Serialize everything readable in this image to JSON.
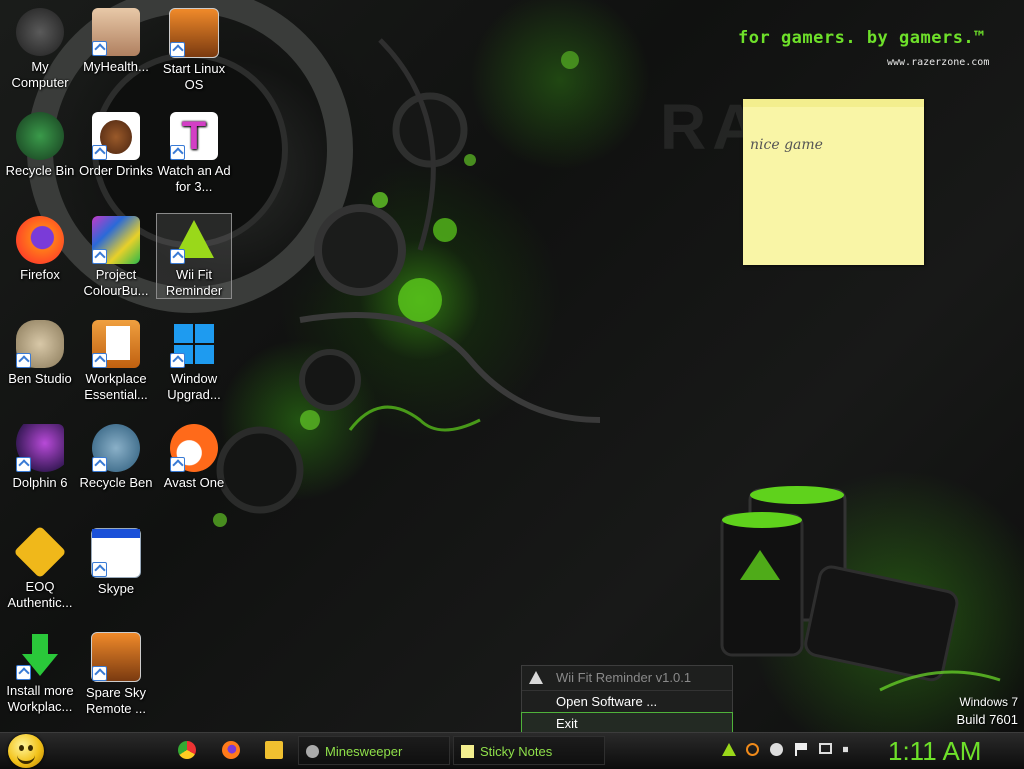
{
  "wallpaper": {
    "tagline": "for gamers. by gamers.™",
    "site": "www.razerzone.com",
    "brand_watermark": "RAZER",
    "accent": "#6ee02a"
  },
  "desktop_icons": [
    {
      "label": "My Computer",
      "icon": "computer-icon",
      "shortcut": false
    },
    {
      "label": "MyHealth...",
      "icon": "avatar-icon",
      "shortcut": true
    },
    {
      "label": "Start Linux OS",
      "icon": "window-app-icon",
      "shortcut": true
    },
    {
      "label": "Recycle Bin",
      "icon": "recycle-bin-icon",
      "shortcut": false
    },
    {
      "label": "Order Drinks",
      "icon": "coffee-bean-icon",
      "shortcut": true
    },
    {
      "label": "Watch an Ad for 3...",
      "icon": "t-letter-icon",
      "shortcut": true
    },
    {
      "label": "Firefox",
      "icon": "firefox-icon",
      "shortcut": false
    },
    {
      "label": "Project ColourBu...",
      "icon": "photo-collage-icon",
      "shortcut": true
    },
    {
      "label": "Wii Fit Reminder",
      "icon": "warning-icon",
      "shortcut": true
    },
    {
      "label": "Ben Studio",
      "icon": "dog-icon",
      "shortcut": true
    },
    {
      "label": "Workplace Essential...",
      "icon": "folder-document-icon",
      "shortcut": true
    },
    {
      "label": "Window Upgrad...",
      "icon": "windows-logo-icon",
      "shortcut": true
    },
    {
      "label": "Dolphin 6",
      "icon": "dolphin-icon",
      "shortcut": true
    },
    {
      "label": "Recycle Ben",
      "icon": "ben-face-icon",
      "shortcut": true
    },
    {
      "label": "Avast One",
      "icon": "avast-icon",
      "shortcut": true
    },
    {
      "label": "EOQ Authentic...",
      "icon": "key-badge-icon",
      "shortcut": true
    },
    {
      "label": "Skype",
      "icon": "window-icon",
      "shortcut": true
    },
    {
      "label": "Install more Workplac...",
      "icon": "download-arrow-icon",
      "shortcut": true
    },
    {
      "label": "Spare Sky Remote ...",
      "icon": "window-app-icon",
      "shortcut": true
    }
  ],
  "sticky_note": {
    "text": "nice game"
  },
  "tray_menu": {
    "title": "Wii Fit Reminder v1.0.1",
    "items": [
      "Open Software ...",
      "Exit"
    ],
    "hovered": "Exit"
  },
  "watermark": {
    "line1": "Windows 7",
    "line2": "Build 7601"
  },
  "taskbar": {
    "pinned": [
      "chrome-icon",
      "firefox-icon",
      "explorer-folder-icon"
    ],
    "windows": [
      {
        "label": "Minesweeper",
        "icon": "mine-icon"
      },
      {
        "label": "Sticky Notes",
        "icon": "sticky-notes-icon"
      }
    ],
    "tray": [
      "warning-icon",
      "search-icon",
      "minus-circle-icon",
      "flag-icon",
      "network-icon",
      "volume-icon"
    ],
    "clock": "1:11 AM"
  }
}
